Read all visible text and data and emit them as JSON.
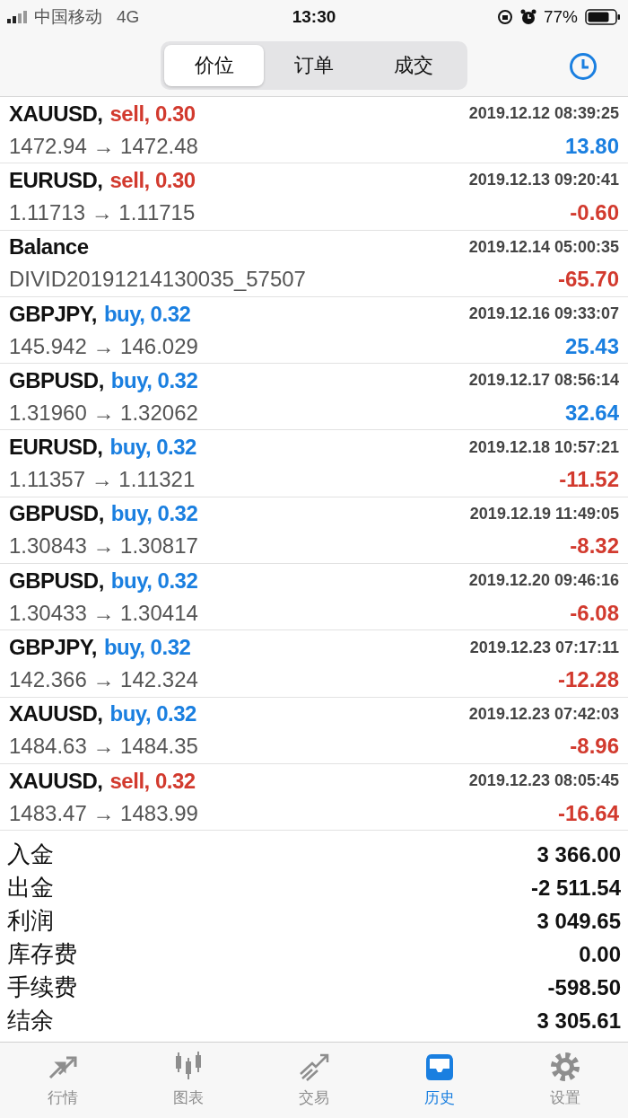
{
  "status_bar": {
    "carrier": "中国移动",
    "network": "4G",
    "time": "13:30",
    "battery": "77%"
  },
  "segments": [
    {
      "label": "价位",
      "selected": true
    },
    {
      "label": "订单",
      "selected": false
    },
    {
      "label": "成交",
      "selected": false
    }
  ],
  "deals": [
    {
      "kind": "trade",
      "symbol": "XAUUSD,",
      "order": {
        "text": "sell, 0.30",
        "color": "#d23a2e"
      },
      "time": "2019.12.12 08:39:25",
      "prices": "1472.94 → 1472.48",
      "profit": {
        "text": "13.80",
        "color": "#1a7fe0"
      }
    },
    {
      "kind": "trade",
      "symbol": "EURUSD,",
      "order": {
        "text": "sell, 0.30",
        "color": "#d23a2e"
      },
      "time": "2019.12.13 09:20:41",
      "prices": "1.11713 → 1.11715",
      "profit": {
        "text": "-0.60",
        "color": "#d23a2e"
      }
    },
    {
      "kind": "balance",
      "symbol": "Balance",
      "time": "2019.12.14 05:00:35",
      "prices": "DIVID20191214130035_57507",
      "profit": {
        "text": "-65.70",
        "color": "#d23a2e"
      }
    },
    {
      "kind": "trade",
      "symbol": "GBPJPY,",
      "order": {
        "text": "buy, 0.32",
        "color": "#1a7fe0"
      },
      "time": "2019.12.16 09:33:07",
      "prices": "145.942 → 146.029",
      "profit": {
        "text": "25.43",
        "color": "#1a7fe0"
      }
    },
    {
      "kind": "trade",
      "symbol": "GBPUSD,",
      "order": {
        "text": "buy, 0.32",
        "color": "#1a7fe0"
      },
      "time": "2019.12.17 08:56:14",
      "prices": "1.31960 → 1.32062",
      "profit": {
        "text": "32.64",
        "color": "#1a7fe0"
      }
    },
    {
      "kind": "trade",
      "symbol": "EURUSD,",
      "order": {
        "text": "buy, 0.32",
        "color": "#1a7fe0"
      },
      "time": "2019.12.18 10:57:21",
      "prices": "1.11357 → 1.11321",
      "profit": {
        "text": "-11.52",
        "color": "#d23a2e"
      }
    },
    {
      "kind": "trade",
      "symbol": "GBPUSD,",
      "order": {
        "text": "buy, 0.32",
        "color": "#1a7fe0"
      },
      "time": "2019.12.19 11:49:05",
      "prices": "1.30843 → 1.30817",
      "profit": {
        "text": "-8.32",
        "color": "#d23a2e"
      }
    },
    {
      "kind": "trade",
      "symbol": "GBPUSD,",
      "order": {
        "text": "buy, 0.32",
        "color": "#1a7fe0"
      },
      "time": "2019.12.20 09:46:16",
      "prices": "1.30433 → 1.30414",
      "profit": {
        "text": "-6.08",
        "color": "#d23a2e"
      }
    },
    {
      "kind": "trade",
      "symbol": "GBPJPY,",
      "order": {
        "text": "buy, 0.32",
        "color": "#1a7fe0"
      },
      "time": "2019.12.23 07:17:11",
      "prices": "142.366 → 142.324",
      "profit": {
        "text": "-12.28",
        "color": "#d23a2e"
      }
    },
    {
      "kind": "trade",
      "symbol": "XAUUSD,",
      "order": {
        "text": "buy, 0.32",
        "color": "#1a7fe0"
      },
      "time": "2019.12.23 07:42:03",
      "prices": "1484.63 → 1484.35",
      "profit": {
        "text": "-8.96",
        "color": "#d23a2e"
      }
    },
    {
      "kind": "trade",
      "symbol": "XAUUSD,",
      "order": {
        "text": "sell, 0.32",
        "color": "#d23a2e"
      },
      "time": "2019.12.23 08:05:45",
      "prices": "1483.47 → 1483.99",
      "profit": {
        "text": "-16.64",
        "color": "#d23a2e"
      }
    }
  ],
  "summary": [
    {
      "label": "入金",
      "value": "3 366.00"
    },
    {
      "label": "出金",
      "value": "-2 511.54"
    },
    {
      "label": "利润",
      "value": "3 049.65"
    },
    {
      "label": "库存费",
      "value": "0.00"
    },
    {
      "label": "手续费",
      "value": "-598.50"
    },
    {
      "label": "结余",
      "value": "3 305.61"
    }
  ],
  "tab_bar": [
    {
      "kind": "quotes",
      "label": "行情",
      "selected": false
    },
    {
      "kind": "chart",
      "label": "图表",
      "selected": false
    },
    {
      "kind": "trade",
      "label": "交易",
      "selected": false
    },
    {
      "kind": "history",
      "label": "历史",
      "selected": true
    },
    {
      "kind": "settings",
      "label": "设置",
      "selected": false
    }
  ]
}
